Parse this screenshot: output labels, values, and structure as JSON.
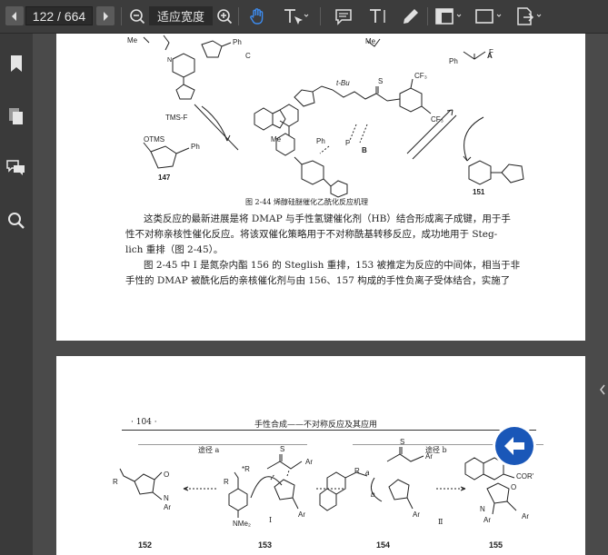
{
  "toolbar": {
    "page_indicator": "122 / 664",
    "zoom_label": "适应宽度"
  },
  "page1": {
    "figure_caption": "图 2-44   烯醇硅醚催化乙酰化反应机理",
    "labels": {
      "C": "C",
      "A": "A",
      "B": "B",
      "n147": "147",
      "n151": "151",
      "tms_f": "TMS-F",
      "otms": "OTMS",
      "ph1": "Ph",
      "ph2": "Ph",
      "ph3": "Ph",
      "ph_acyl": "Ph",
      "f_a": "F",
      "me1": "Me",
      "me2": "Me",
      "me3": "Me",
      "tbu": "t-Bu",
      "cf3a": "CF₃",
      "cf3b": "CF₃",
      "s": "S",
      "f_anion": "F",
      "n_plus": "N"
    },
    "paragraphs": [
      "这类反应的最新进展是将 DMAP 与手性氢键催化剂（HB）结合形成离子成键，用于手",
      "性不对称亲核性催化反应。将该双催化策略用于不对称酰基转移反应，成功地用于 Steg-",
      "lich 重排（图 2-45）。",
      "图 2-45 中 Ⅰ 是氮杂内酯 156 的 Steglish 重排，153 被推定为反应的中间体，相当于非",
      "手性的 DMAP 被酰化后的亲核催化剂与由 156、157 构成的手性负离子受体结合，实施了"
    ]
  },
  "page2": {
    "page_number": "· 104 ·",
    "running_title": "手性合成——不对称反应及其应用",
    "route_a": "途径 a",
    "route_b": "途径 b",
    "compounds": [
      "152",
      "153",
      "154",
      "155"
    ],
    "roman": [
      "Ⅰ",
      "Ⅱ"
    ],
    "labels": {
      "r1": "R",
      "r2": "R",
      "r3": "R",
      "ar1": "Ar",
      "ar2": "Ar",
      "ar3": "Ar",
      "ar4": "Ar",
      "ar5": "Ar",
      "ar6": "Ar",
      "s1": "S",
      "s2": "S",
      "nme2": "NMe₂",
      "cor": "COR'",
      "a_label": "a",
      "b_label": "b",
      "o1": "O",
      "o2": "O",
      "n1": "N",
      "n2": "N",
      "rstar": "*R",
      "ar_end": "Ar"
    }
  },
  "colors": {
    "toolbar_bg": "#3c3c3c",
    "accent_blue": "#1a6ad8",
    "back_button": "#1a57b8"
  },
  "icons": [
    "prev-page-icon",
    "next-page-icon",
    "zoom-out-icon",
    "zoom-in-icon",
    "hand-tool-icon",
    "text-select-icon",
    "comment-icon",
    "text-icon",
    "pen-icon",
    "view-mode-icon",
    "shape-icon",
    "export-icon",
    "bookmark-icon",
    "pages-icon",
    "comments-panel-icon",
    "search-icon",
    "back-arrow-icon"
  ]
}
